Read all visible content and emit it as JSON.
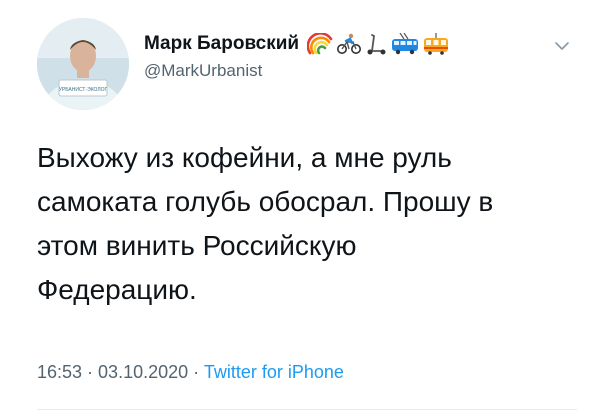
{
  "author": {
    "display_name": "Марк Баровский",
    "handle": "@MarkUrbanist",
    "avatar_sign_text": "УРБАНИСТ·ЭКОЛОГ",
    "name_emojis": [
      "rainbow-emoji",
      "cyclist-emoji",
      "scooter-emoji",
      "trolleybus-emoji",
      "tram-emoji"
    ]
  },
  "tweet": {
    "lines": [
      "Выхожу из кофейни, а мне руль",
      "самоката голубь обосрал. Прошу в",
      "этом винить Российскую",
      "Федерацию."
    ]
  },
  "meta": {
    "time": "16:53",
    "separator1": " · ",
    "date": "03.10.2020",
    "separator2": " · ",
    "source": "Twitter for iPhone"
  },
  "colors": {
    "text": "#0f1419",
    "secondary": "#536471",
    "link": "#1d9bf0"
  }
}
